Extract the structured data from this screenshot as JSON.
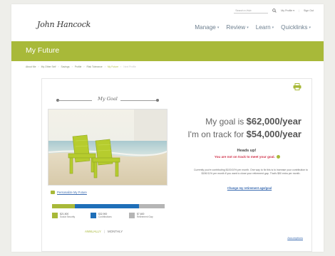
{
  "header": {
    "search_placeholder": "Search e-Hub",
    "my_profile": "My Profile",
    "sign_out": "Sign Out",
    "logo_text": "John Hancock"
  },
  "nav": {
    "items": [
      {
        "label": "Manage"
      },
      {
        "label": "Review"
      },
      {
        "label": "Learn"
      },
      {
        "label": "Quicklinks"
      }
    ]
  },
  "banner": {
    "title": "My Future"
  },
  "breadcrumb": {
    "items": [
      "About Me",
      "My Other Self",
      "Savings",
      "Profile",
      "Risk Tolerance",
      "My Future",
      "Next Profile"
    ]
  },
  "goal": {
    "heading": "My Goal",
    "goal_prefix": "My goal is",
    "goal_value": "$62,000/year",
    "track_prefix": "I'm on track for",
    "track_value": "$54,000/year",
    "heads_up": "Heads up!",
    "warning": "You are not on track to meet your goal.",
    "paragraph": "Currently you're contributing $100/10% per month. One way to fix this is to increase your contribution to $150/11% per month if you want to close your retirement gap. That's $50 extra per month.",
    "change_link": "Change my retirement age/goal",
    "personalize_link": "Personalize My Future",
    "assumptions_link": "Assumptions"
  },
  "breakdown": {
    "segments": [
      {
        "name": "Social Security",
        "amount": "$21,500",
        "fraction": 0.2,
        "color": "#a8b939"
      },
      {
        "name": "Contributions",
        "amount": "$32,900",
        "fraction": 0.57,
        "color": "#1f6fb8"
      },
      {
        "name": "Retirement Gap",
        "amount": "$7,600",
        "fraction": 0.23,
        "color": "#b5b5b5"
      }
    ]
  },
  "toggle": {
    "annually": "ANNUALLY",
    "monthly": "MONTHLY",
    "active": "annually"
  },
  "colors": {
    "brand_green": "#a8b939",
    "link_blue": "#3e6eb2",
    "warning_red": "#d0324a"
  },
  "icons": {
    "print": "printer-icon",
    "search": "search-icon"
  }
}
